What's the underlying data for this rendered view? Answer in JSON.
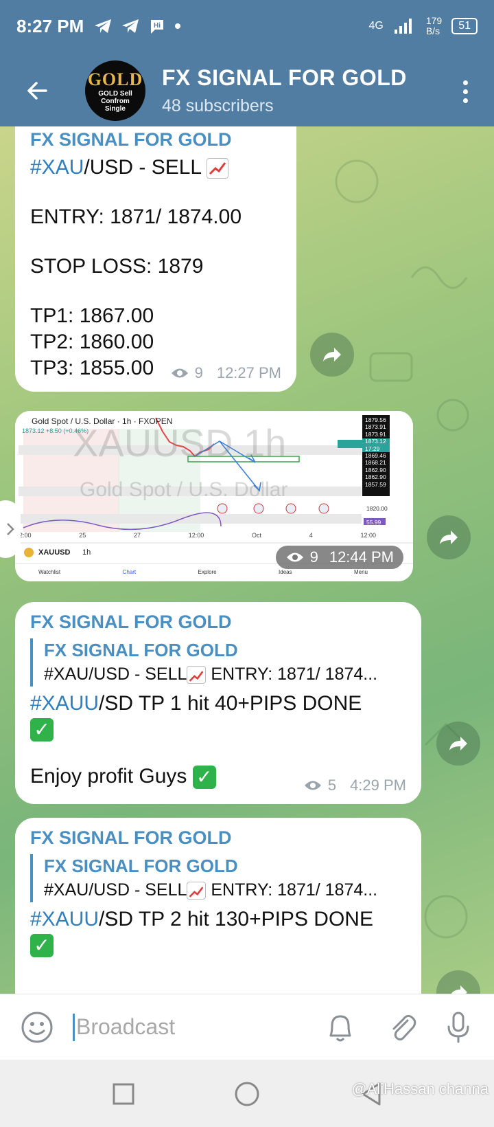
{
  "status_bar": {
    "time": "8:27 PM",
    "network": "4G",
    "speed": "179\nB/s",
    "battery": "51"
  },
  "header": {
    "title": "FX SIGNAL FOR GOLD",
    "subtitle": "48 subscribers",
    "avatar_big": "GOLD",
    "avatar_small": "GOLD Sell\nConfrom\nSingle"
  },
  "messages": [
    {
      "sender": "FX SIGNAL FOR GOLD",
      "line1_tag": "#XAU",
      "line1_rest": "/USD - SELL",
      "entry": "ENTRY: 1871/ 1874.00",
      "stop": "STOP LOSS: 1879",
      "tp1": "TP1: 1867.00",
      "tp2": "TP2: 1860.00",
      "tp3": "TP3: 1855.00",
      "views": "9",
      "time": "12:27 PM"
    },
    {
      "chart_title": "Gold Spot / U.S. Dollar · 1h · FXOPEN",
      "chart_price": "1873.12 +8.50 (+0.46%)",
      "chart_watermark": "XAUUSD 1h",
      "chart_watermark2": "Gold Spot / U.S. Dollar",
      "prices": [
        "1879.56",
        "1873.91",
        "1873.91",
        "1873.12",
        "17:29",
        "1869.46",
        "1868.21",
        "1862.90",
        "1862.90",
        "1857.59",
        "1820.00",
        "55.99"
      ],
      "xaxis": [
        "2:00",
        "25",
        "27",
        "12:00",
        "Oct",
        "4",
        "12:00"
      ],
      "symbol": "XAUUSD",
      "interval": "1h",
      "tabs": [
        "Watchlist",
        "Chart",
        "Explore",
        "Ideas",
        "Menu"
      ],
      "views": "9",
      "time": "12:44 PM"
    },
    {
      "sender": "FX SIGNAL FOR GOLD",
      "quote_title": "FX SIGNAL FOR GOLD",
      "quote_a": "#XAU/USD - SELL",
      "quote_b": "  ENTRY: 1871/ 1874...",
      "body_tag": "#XAUU",
      "body_rest": "/SD TP 1 hit 40+PIPS DONE",
      "enjoy": "Enjoy profit Guys",
      "views": "5",
      "time": "4:29 PM"
    },
    {
      "sender": "FX SIGNAL FOR GOLD",
      "quote_title": "FX SIGNAL FOR GOLD",
      "quote_a": "#XAU/USD - SELL",
      "quote_b": "  ENTRY: 1871/ 1874...",
      "body_tag": "#XAUU",
      "body_rest": "/SD TP 2 hit 130+PIPS DONE"
    }
  ],
  "input": {
    "placeholder": "Broadcast"
  },
  "watermark": "@AliHassan channa",
  "colors": {
    "header": "#517da2",
    "accent": "#4a8fc2",
    "check": "#2fb24a"
  }
}
